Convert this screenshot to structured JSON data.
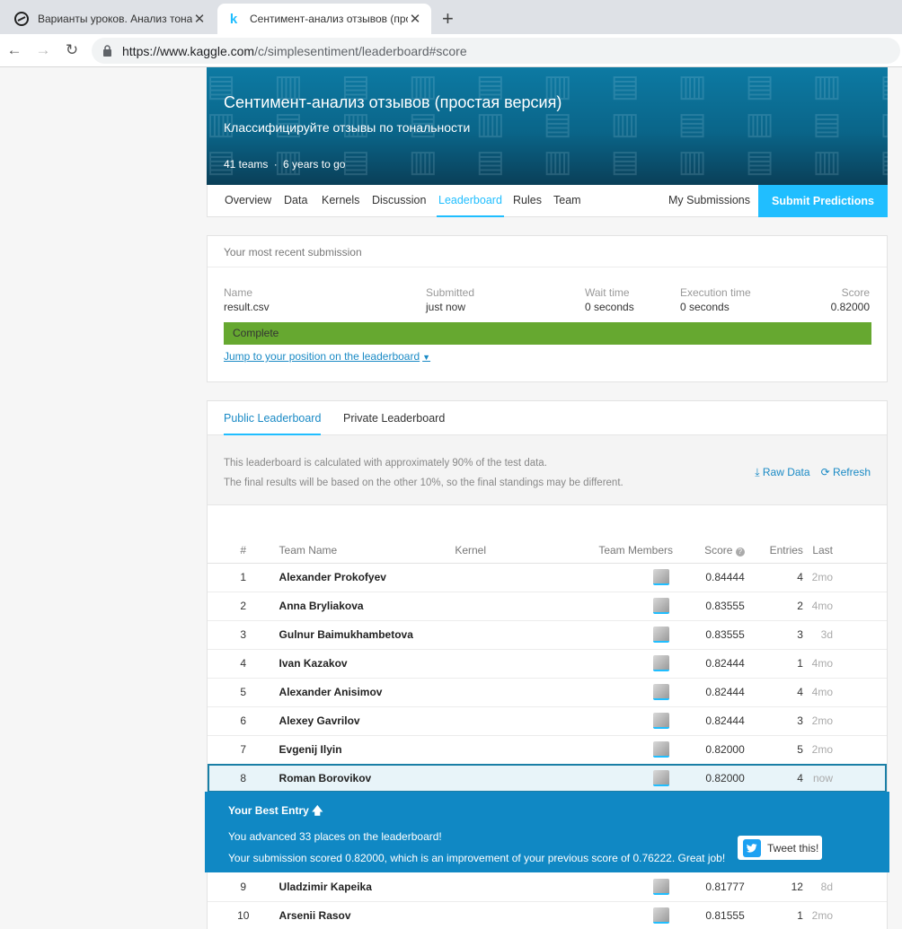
{
  "browser": {
    "tabs": [
      {
        "title": "Варианты уроков. Анализ тональности",
        "active": false
      },
      {
        "title": "Сентимент-анализ отзывов (простая версия)",
        "active": true
      }
    ],
    "url_host": "https://www.kaggle.com",
    "url_path": "/c/simplesentiment/leaderboard#score"
  },
  "competition": {
    "title": "Сентимент-анализ отзывов (простая версия)",
    "subtitle": "Классифицируйте отзывы по тональности",
    "teams": "41 teams",
    "separator": "·",
    "time_left": "6 years to go"
  },
  "nav": {
    "items": [
      "Overview",
      "Data",
      "Kernels",
      "Discussion",
      "Leaderboard",
      "Rules",
      "Team"
    ],
    "active": "Leaderboard",
    "my_submissions": "My Submissions",
    "submit": "Submit Predictions"
  },
  "recent": {
    "heading": "Your most recent submission",
    "name_label": "Name",
    "name": "result.csv",
    "submitted_label": "Submitted",
    "submitted": "just now",
    "wait_label": "Wait time",
    "wait": "0 seconds",
    "exec_label": "Execution time",
    "exec": "0 seconds",
    "score_label": "Score",
    "score": "0.82000",
    "status": "Complete",
    "jump": "Jump to your position on the leaderboard"
  },
  "leaderboard": {
    "tabs": [
      "Public Leaderboard",
      "Private Leaderboard"
    ],
    "info_line1": "This leaderboard is calculated with approximately 90% of the test data.",
    "info_line2": "The final results will be based on the other 10%, so the final standings may be different.",
    "raw_data": "Raw Data",
    "refresh": "Refresh",
    "headers": {
      "rank": "#",
      "team": "Team Name",
      "kernel": "Kernel",
      "members": "Team Members",
      "score": "Score",
      "entries": "Entries",
      "last": "Last"
    },
    "rows": [
      {
        "rank": "1",
        "name": "Alexander Prokofyev",
        "score": "0.84444",
        "entries": "4",
        "last": "2mo"
      },
      {
        "rank": "2",
        "name": "Anna Bryliakova",
        "score": "0.83555",
        "entries": "2",
        "last": "4mo"
      },
      {
        "rank": "3",
        "name": "Gulnur Baimukhambetova",
        "score": "0.83555",
        "entries": "3",
        "last": "3d"
      },
      {
        "rank": "4",
        "name": "Ivan Kazakov",
        "score": "0.82444",
        "entries": "1",
        "last": "4mo"
      },
      {
        "rank": "5",
        "name": "Alexander Anisimov",
        "score": "0.82444",
        "entries": "4",
        "last": "4mo"
      },
      {
        "rank": "6",
        "name": "Alexey Gavrilov",
        "score": "0.82444",
        "entries": "3",
        "last": "2mo"
      },
      {
        "rank": "7",
        "name": "Evgenij Ilyin",
        "score": "0.82000",
        "entries": "5",
        "last": "2mo"
      },
      {
        "rank": "8",
        "name": "Roman Borovikov",
        "score": "0.82000",
        "entries": "4",
        "last": "now"
      }
    ],
    "rows_after": [
      {
        "rank": "9",
        "name": "Uladzimir Kapeika",
        "score": "0.81777",
        "entries": "12",
        "last": "8d"
      },
      {
        "rank": "10",
        "name": "Arsenii Rasov",
        "score": "0.81555",
        "entries": "1",
        "last": "2mo"
      }
    ]
  },
  "best_entry": {
    "title": "Your Best Entry",
    "line1": "You advanced 33 places on the leaderboard!",
    "line2": "Your submission scored 0.82000, which is an improvement of your previous score of 0.76222. Great job!",
    "tweet": "Tweet this!"
  },
  "colors": {
    "accent": "#20beff",
    "complete": "#66a830",
    "best_bg": "#1088c4"
  }
}
